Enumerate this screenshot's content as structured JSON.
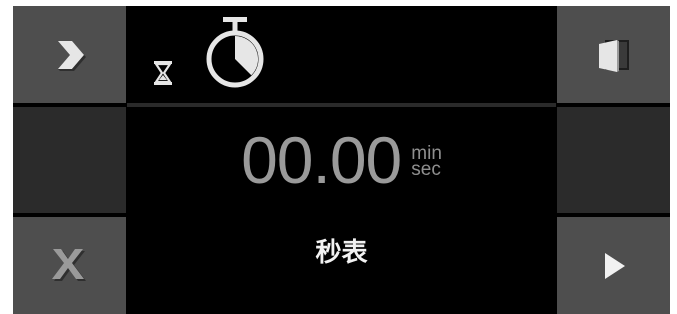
{
  "timer": {
    "value": "00.00",
    "unit_top": "min",
    "unit_bottom": "sec"
  },
  "mode_label": "秒表",
  "icons": {
    "forward": "chevron-right-icon",
    "close": "close-x-icon",
    "exit": "door-exit-icon",
    "play": "play-icon",
    "hourglass": "hourglass-icon",
    "stopwatch": "stopwatch-icon"
  },
  "colors": {
    "screen_bg": "#000000",
    "button_bg": "#4e4e4e",
    "button_dark": "#2b2b2b",
    "time_text": "#9a9a9a",
    "label_text": "#f2f2f2"
  }
}
